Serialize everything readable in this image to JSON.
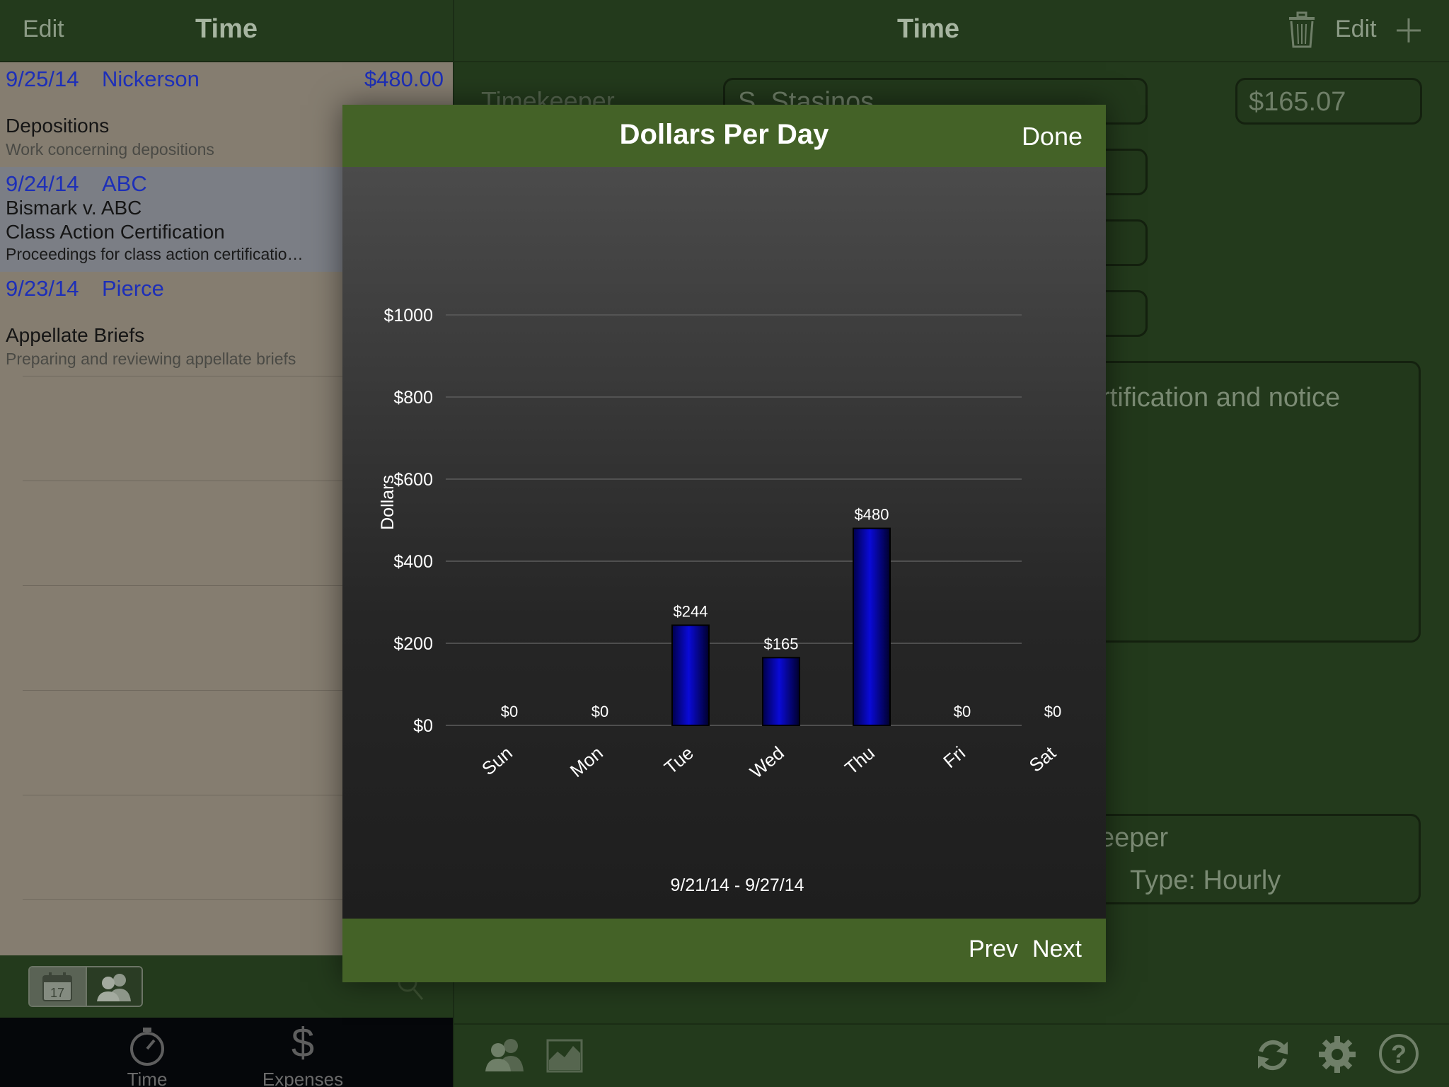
{
  "left_pane": {
    "nav": {
      "edit_label": "Edit",
      "title": "Time"
    },
    "entries": [
      {
        "date": "9/25/14",
        "client": "Nickerson",
        "amount": "$480.00",
        "line1": "",
        "line2": "Depositions",
        "line3": "Work concerning depositions"
      },
      {
        "date": "9/24/14",
        "client": "ABC",
        "amount": "",
        "line1": "Bismark v. ABC",
        "line2": "Class Action Certification",
        "line3": "Proceedings for class action certificatio…"
      },
      {
        "date": "9/23/14",
        "client": "Pierce",
        "amount": "",
        "line1": "",
        "line2": "Appellate Briefs",
        "line3": "Preparing and reviewing appellate briefs"
      }
    ],
    "segment": {
      "calendar_day": "17"
    },
    "tabs": [
      {
        "label": "Time"
      },
      {
        "label": "Expenses"
      }
    ]
  },
  "right_pane": {
    "nav": {
      "title": "Time",
      "edit_label": "Edit"
    },
    "timekeeper_label": "Timekeeper",
    "timekeeper_value": "S. Stasinos",
    "amount_value": "$165.07",
    "notes_fragment": "ertification and notice",
    "keeper_fragment": "keeper",
    "type_text": "Type: Hourly"
  },
  "modal": {
    "title": "Dollars Per Day",
    "done_label": "Done",
    "prev_label": "Prev",
    "next_label": "Next"
  },
  "chart_data": {
    "type": "bar",
    "title": "Dollars Per Day",
    "categories": [
      "Sun",
      "Mon",
      "Tue",
      "Wed",
      "Thu",
      "Fri",
      "Sat"
    ],
    "values": [
      0,
      0,
      244,
      165,
      480,
      0,
      0
    ],
    "value_labels": [
      "$0",
      "$0",
      "$244",
      "$165",
      "$480",
      "$0",
      "$0"
    ],
    "ylabel": "Dollars",
    "xlabel": "9/21/14 - 9/27/14",
    "ylim": [
      0,
      1000
    ],
    "yticks": [
      0,
      200,
      400,
      600,
      800,
      1000
    ],
    "ytick_labels": [
      "$0",
      "$200",
      "$400",
      "$600",
      "$800",
      "$1000"
    ],
    "grid": true,
    "bar_color": "#0a0ad8"
  }
}
